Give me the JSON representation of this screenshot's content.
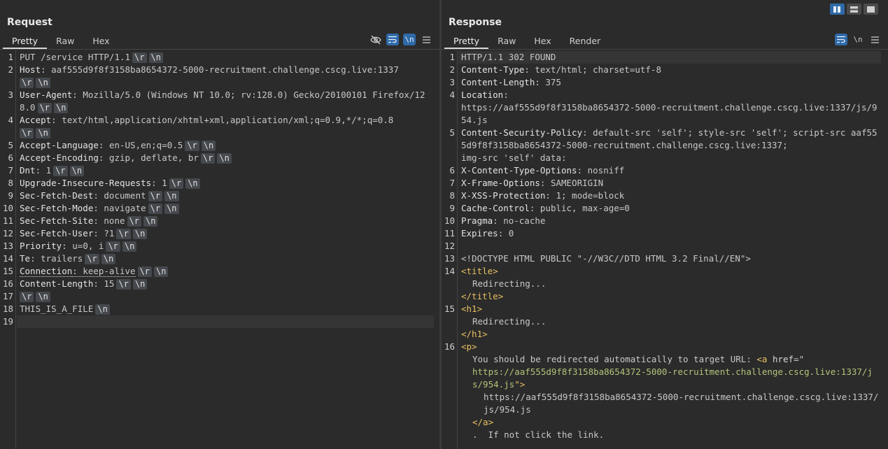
{
  "layout": {
    "buttons": [
      {
        "name": "side-by-side",
        "active": true
      },
      {
        "name": "top-bottom",
        "active": false
      },
      {
        "name": "single",
        "active": false
      }
    ]
  },
  "request": {
    "title": "Request",
    "tabs": [
      "Pretty",
      "Raw",
      "Hex"
    ],
    "active_tab": "Pretty",
    "toolbar_icons": [
      "hide-eye-icon",
      "wrap-icon",
      "newline-icon",
      "menu-icon"
    ],
    "newline_label": "\\n",
    "lines": [
      {
        "n": "1",
        "parts": [
          [
            "t",
            "PUT /service HTTP/1.1"
          ],
          [
            "e",
            "\\r"
          ],
          [
            "e",
            "\\n"
          ]
        ]
      },
      {
        "n": "2",
        "parts": [
          [
            "k",
            "Host"
          ],
          [
            "t",
            ": aaf555d9f8f3158ba8654372-5000-recruitment.challenge.cscg.live:1337"
          ],
          [
            "br",
            ""
          ],
          [
            "e0",
            "\\r"
          ],
          [
            "e",
            "\\n"
          ]
        ]
      },
      {
        "n": "3",
        "parts": [
          [
            "k",
            "User-Agent"
          ],
          [
            "t",
            ": Mozilla/5.0 (Windows NT 10.0; rv:128.0) Gecko/20100101 Firefox/128.0"
          ],
          [
            "e",
            "\\r"
          ],
          [
            "e",
            "\\n"
          ]
        ]
      },
      {
        "n": "4",
        "parts": [
          [
            "k",
            "Accept"
          ],
          [
            "t",
            ": text/html,application/xhtml+xml,application/xml;q=0.9,*/*;q=0.8"
          ],
          [
            "br",
            ""
          ],
          [
            "e0",
            "\\r"
          ],
          [
            "e",
            "\\n"
          ]
        ]
      },
      {
        "n": "5",
        "parts": [
          [
            "k",
            "Accept-Language"
          ],
          [
            "t",
            ": en-US,en;q=0.5"
          ],
          [
            "e",
            "\\r"
          ],
          [
            "e",
            "\\n"
          ]
        ]
      },
      {
        "n": "6",
        "parts": [
          [
            "k",
            "Accept-Encoding"
          ],
          [
            "t",
            ": gzip, deflate, br"
          ],
          [
            "e",
            "\\r"
          ],
          [
            "e",
            "\\n"
          ]
        ]
      },
      {
        "n": "7",
        "parts": [
          [
            "k",
            "Dnt"
          ],
          [
            "t",
            ": 1"
          ],
          [
            "e",
            "\\r"
          ],
          [
            "e",
            "\\n"
          ]
        ]
      },
      {
        "n": "8",
        "parts": [
          [
            "k",
            "Upgrade-Insecure-Requests"
          ],
          [
            "t",
            ": 1"
          ],
          [
            "e",
            "\\r"
          ],
          [
            "e",
            "\\n"
          ]
        ]
      },
      {
        "n": "9",
        "parts": [
          [
            "k",
            "Sec-Fetch-Dest"
          ],
          [
            "t",
            ": document"
          ],
          [
            "e",
            "\\r"
          ],
          [
            "e",
            "\\n"
          ]
        ]
      },
      {
        "n": "10",
        "parts": [
          [
            "k",
            "Sec-Fetch-Mode"
          ],
          [
            "t",
            ": navigate"
          ],
          [
            "e",
            "\\r"
          ],
          [
            "e",
            "\\n"
          ]
        ]
      },
      {
        "n": "11",
        "parts": [
          [
            "k",
            "Sec-Fetch-Site"
          ],
          [
            "t",
            ": none"
          ],
          [
            "e",
            "\\r"
          ],
          [
            "e",
            "\\n"
          ]
        ]
      },
      {
        "n": "12",
        "parts": [
          [
            "k",
            "Sec-Fetch-User"
          ],
          [
            "t",
            ": ?1"
          ],
          [
            "e",
            "\\r"
          ],
          [
            "e",
            "\\n"
          ]
        ]
      },
      {
        "n": "13",
        "parts": [
          [
            "k",
            "Priority"
          ],
          [
            "t",
            ": u=0, i"
          ],
          [
            "e",
            "\\r"
          ],
          [
            "e",
            "\\n"
          ]
        ]
      },
      {
        "n": "14",
        "parts": [
          [
            "k",
            "Te"
          ],
          [
            "t",
            ": trailers"
          ],
          [
            "e",
            "\\r"
          ],
          [
            "e",
            "\\n"
          ]
        ]
      },
      {
        "n": "15",
        "parts": [
          [
            "kd",
            "Connection"
          ],
          [
            "td",
            ": keep-alive"
          ],
          [
            "e",
            "\\r"
          ],
          [
            "e",
            "\\n"
          ]
        ]
      },
      {
        "n": "16",
        "parts": [
          [
            "k",
            "Content-Length"
          ],
          [
            "t",
            ": 15"
          ],
          [
            "e",
            "\\r"
          ],
          [
            "e",
            "\\n"
          ]
        ]
      },
      {
        "n": "17",
        "parts": [
          [
            "e0",
            "\\r"
          ],
          [
            "e",
            "\\n"
          ]
        ]
      },
      {
        "n": "18",
        "parts": [
          [
            "t",
            "THIS_IS_A_FILE"
          ],
          [
            "e",
            "\\n"
          ]
        ]
      },
      {
        "n": "19",
        "parts": [],
        "highlight": true
      }
    ]
  },
  "response": {
    "title": "Response",
    "tabs": [
      "Pretty",
      "Raw",
      "Hex",
      "Render"
    ],
    "active_tab": "Pretty",
    "toolbar_icons": [
      "wrap-icon",
      "newline-icon",
      "menu-icon"
    ],
    "newline_label": "\\n",
    "lines": [
      {
        "n": "1",
        "parts": [
          [
            "t",
            "HTTP/1.1 302 FOUND"
          ]
        ],
        "highlight": true
      },
      {
        "n": "2",
        "parts": [
          [
            "k",
            "Content-Type"
          ],
          [
            "t",
            ": text/html; charset=utf-8"
          ]
        ]
      },
      {
        "n": "3",
        "parts": [
          [
            "k",
            "Content-Length"
          ],
          [
            "t",
            ": 375"
          ]
        ]
      },
      {
        "n": "4",
        "parts": [
          [
            "k",
            "Location"
          ],
          [
            "t",
            ":"
          ],
          [
            "br",
            ""
          ],
          [
            "t",
            "https://aaf555d9f8f3158ba8654372-5000-recruitment.challenge.cscg.live:1337/js/954.js"
          ]
        ]
      },
      {
        "n": "5",
        "parts": [
          [
            "k",
            "Content-Security-Policy"
          ],
          [
            "t",
            ": default-src 'self'; style-src 'self'; script-src aaf555d9f8f3158ba8654372-5000-recruitment.challenge.cscg.live:1337;"
          ],
          [
            "br",
            ""
          ],
          [
            "t",
            "img-src 'self' data:"
          ]
        ]
      },
      {
        "n": "6",
        "parts": [
          [
            "k",
            "X-Content-Type-Options"
          ],
          [
            "t",
            ": nosniff"
          ]
        ]
      },
      {
        "n": "7",
        "parts": [
          [
            "k",
            "X-Frame-Options"
          ],
          [
            "t",
            ": SAMEORIGIN"
          ]
        ]
      },
      {
        "n": "8",
        "parts": [
          [
            "k",
            "X-XSS-Protection"
          ],
          [
            "t",
            ": 1; mode=block"
          ]
        ]
      },
      {
        "n": "9",
        "parts": [
          [
            "k",
            "Cache-Control"
          ],
          [
            "t",
            ": public, max-age=0"
          ]
        ]
      },
      {
        "n": "10",
        "parts": [
          [
            "k",
            "Pragma"
          ],
          [
            "t",
            ": no-cache"
          ]
        ]
      },
      {
        "n": "11",
        "parts": [
          [
            "k",
            "Expires"
          ],
          [
            "t",
            ": 0"
          ]
        ]
      },
      {
        "n": "12",
        "parts": []
      },
      {
        "n": "13",
        "parts": [
          [
            "t",
            "<!DOCTYPE HTML PUBLIC \"-//W3C//DTD HTML 3.2 Final//EN\">"
          ]
        ]
      },
      {
        "n": "14",
        "parts": [
          [
            "tag",
            "<title>"
          ]
        ]
      },
      {
        "n": "",
        "parts": [
          [
            "i1",
            "Redirecting..."
          ]
        ]
      },
      {
        "n": "",
        "parts": [
          [
            "tag",
            "</title>"
          ]
        ]
      },
      {
        "n": "15",
        "parts": [
          [
            "tag",
            "<h1>"
          ]
        ]
      },
      {
        "n": "",
        "parts": [
          [
            "i1",
            "Redirecting..."
          ]
        ]
      },
      {
        "n": "",
        "parts": [
          [
            "tag",
            "</h1>"
          ]
        ]
      },
      {
        "n": "16",
        "parts": [
          [
            "tag",
            "<p>"
          ]
        ]
      },
      {
        "n": "",
        "parts": [
          [
            "i1",
            "You should be redirected automatically to target URL: "
          ],
          [
            "tag",
            "<a "
          ],
          [
            "attr",
            "href"
          ],
          [
            "t",
            "=\""
          ]
        ]
      },
      {
        "n": "",
        "parts": [
          [
            "i1s",
            "https://aaf555d9f8f3158ba8654372-5000-recruitment.challenge.cscg.live:1337/js/954.js"
          ],
          [
            "tag",
            "\">"
          ]
        ]
      },
      {
        "n": "",
        "parts": [
          [
            "i2",
            "https://aaf555d9f8f3158ba8654372-5000-recruitment.challenge.cscg.live:1337/js/954.js"
          ]
        ]
      },
      {
        "n": "",
        "parts": [
          [
            "i1t",
            "</a>"
          ]
        ]
      },
      {
        "n": "",
        "parts": [
          [
            "i1",
            ".  If not click the link."
          ]
        ]
      }
    ]
  }
}
